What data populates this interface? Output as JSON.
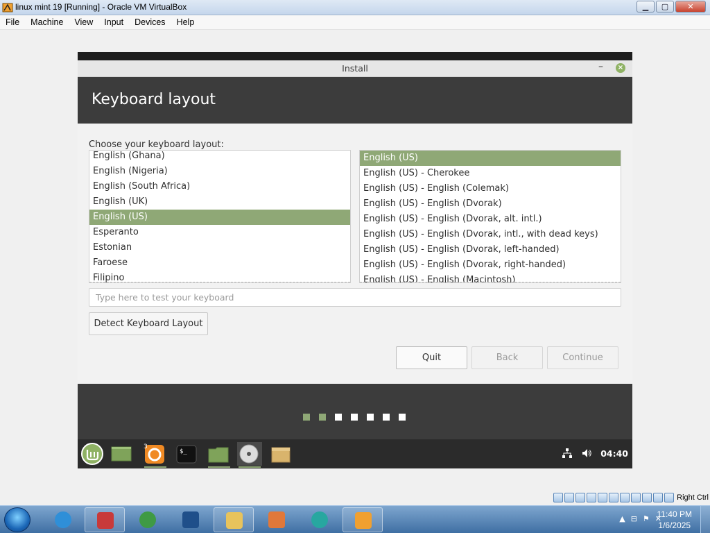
{
  "host": {
    "window_title": "linux mint 19 [Running] - Oracle VM VirtualBox",
    "menu": [
      "File",
      "Machine",
      "View",
      "Input",
      "Devices",
      "Help"
    ],
    "status_host_key": "Right Ctrl"
  },
  "installer": {
    "window_title": "Install",
    "minimize_glyph": "–",
    "close_glyph": "×",
    "heading": "Keyboard layout",
    "choose_label": "Choose your keyboard layout:",
    "layouts": [
      {
        "label": "English (Ghana)",
        "selected": false
      },
      {
        "label": "English (Nigeria)",
        "selected": false
      },
      {
        "label": "English (South Africa)",
        "selected": false
      },
      {
        "label": "English (UK)",
        "selected": false
      },
      {
        "label": "English (US)",
        "selected": true
      },
      {
        "label": "Esperanto",
        "selected": false
      },
      {
        "label": "Estonian",
        "selected": false
      },
      {
        "label": "Faroese",
        "selected": false
      },
      {
        "label": "Filipino",
        "selected": false
      }
    ],
    "variants": [
      {
        "label": "English (US)",
        "selected": true
      },
      {
        "label": "English (US) - Cherokee",
        "selected": false
      },
      {
        "label": "English (US) - English (Colemak)",
        "selected": false
      },
      {
        "label": "English (US) - English (Dvorak)",
        "selected": false
      },
      {
        "label": "English (US) - English (Dvorak, alt. intl.)",
        "selected": false
      },
      {
        "label": "English (US) - English (Dvorak, intl., with dead keys)",
        "selected": false
      },
      {
        "label": "English (US) - English (Dvorak, left-handed)",
        "selected": false
      },
      {
        "label": "English (US) - English (Dvorak, right-handed)",
        "selected": false
      },
      {
        "label": "English (US) - English (Macintosh)",
        "selected": false
      }
    ],
    "test_placeholder": "Type here to test your keyboard",
    "detect_button": "Detect Keyboard Layout",
    "quit_button": "Quit",
    "back_button": "Back",
    "continue_button": "Continue",
    "progress": {
      "total_steps": 7,
      "completed_steps": 2
    }
  },
  "mint_panel": {
    "clock": "04:40",
    "badge": "3"
  },
  "windows_taskbar": {
    "time": "11:40 PM",
    "date": "1/6/2025"
  },
  "colors": {
    "mint_green": "#8fa876",
    "header_dark": "#3c3c3c"
  }
}
